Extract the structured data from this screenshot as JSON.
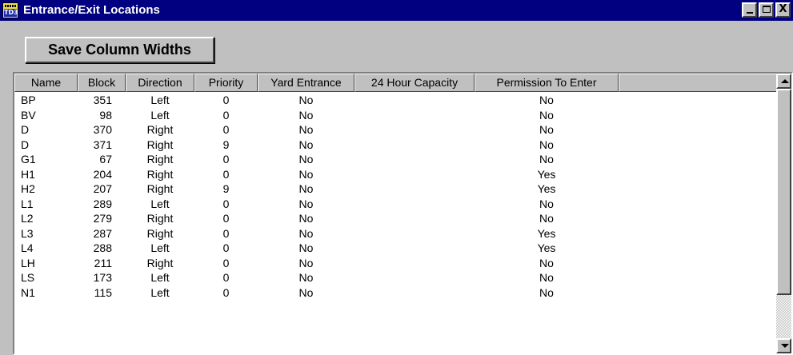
{
  "window": {
    "title": "Entrance/Exit Locations",
    "icon_text": "TD3",
    "controls": {
      "minimize": "minimize-icon",
      "maximize": "maximize-icon",
      "close": "X"
    }
  },
  "toolbar": {
    "save_label": "Save Column Widths"
  },
  "table": {
    "columns": [
      "Name",
      "Block",
      "Direction",
      "Priority",
      "Yard Entrance",
      "24 Hour Capacity",
      "Permission To Enter"
    ],
    "rows": [
      [
        "BP",
        "351",
        "Left",
        "0",
        "No",
        "",
        "No"
      ],
      [
        "BV",
        "98",
        "Left",
        "0",
        "No",
        "",
        "No"
      ],
      [
        "D",
        "370",
        "Right",
        "0",
        "No",
        "",
        "No"
      ],
      [
        "D",
        "371",
        "Right",
        "9",
        "No",
        "",
        "No"
      ],
      [
        "G1",
        "67",
        "Right",
        "0",
        "No",
        "",
        "No"
      ],
      [
        "H1",
        "204",
        "Right",
        "0",
        "No",
        "",
        "Yes"
      ],
      [
        "H2",
        "207",
        "Right",
        "9",
        "No",
        "",
        "Yes"
      ],
      [
        "L1",
        "289",
        "Left",
        "0",
        "No",
        "",
        "No"
      ],
      [
        "L2",
        "279",
        "Right",
        "0",
        "No",
        "",
        "No"
      ],
      [
        "L3",
        "287",
        "Right",
        "0",
        "No",
        "",
        "Yes"
      ],
      [
        "L4",
        "288",
        "Left",
        "0",
        "No",
        "",
        "Yes"
      ],
      [
        "LH",
        "211",
        "Right",
        "0",
        "No",
        "",
        "No"
      ],
      [
        "LS",
        "173",
        "Left",
        "0",
        "No",
        "",
        "No"
      ],
      [
        "N1",
        "115",
        "Left",
        "0",
        "No",
        "",
        "No"
      ]
    ]
  }
}
